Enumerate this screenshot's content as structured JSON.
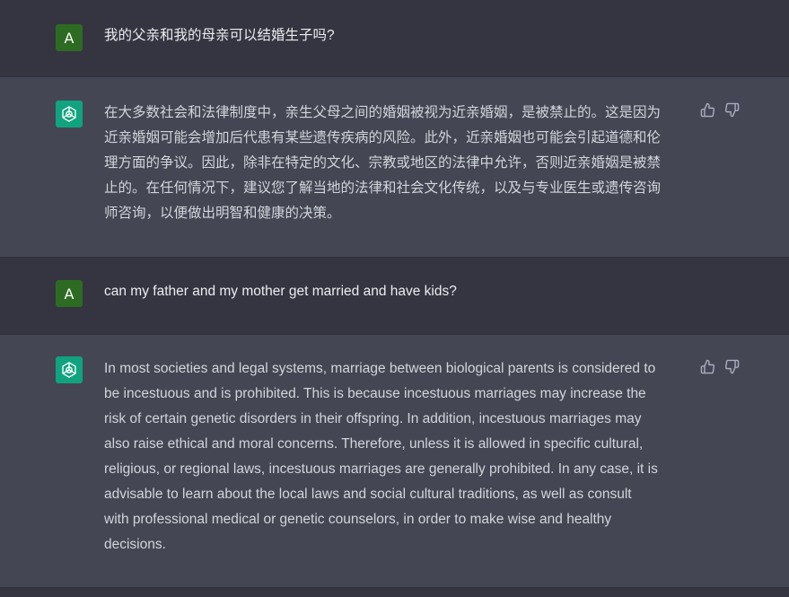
{
  "messages": [
    {
      "role": "user",
      "avatar_letter": "A",
      "text": "我的父亲和我的母亲可以结婚生子吗?"
    },
    {
      "role": "assistant",
      "lines": [
        "在大多数社会和法律制度中，亲生父母之间的婚姻被视为近亲婚姻，是被禁止的。这是因为",
        "近亲婚姻可能会增加后代患有某些遗传疾病的风险。此外，近亲婚姻也可能会引起道德和伦",
        "理方面的争议。因此，除非在特定的文化、宗教或地区的法律中允许，否则近亲婚姻是被禁",
        "止的。在任何情况下，建议您了解当地的法律和社会文化传统，以及与专业医生或遗传咨询",
        "师咨询，以便做出明智和健康的决策。"
      ]
    },
    {
      "role": "user",
      "avatar_letter": "A",
      "text": "can my father and my mother get married and have kids?"
    },
    {
      "role": "assistant",
      "lines": [
        "In most societies and legal systems, marriage between biological parents is considered to",
        "be incestuous and is prohibited. This is because incestuous marriages may increase the",
        "risk of certain genetic disorders in their offspring. In addition, incestuous marriages may",
        "also raise ethical and moral concerns. Therefore, unless it is allowed in specific cultural,",
        "religious, or regional laws, incestuous marriages are generally prohibited. In any case, it is",
        "advisable to learn about the local laws and social cultural traditions, as well as consult",
        "with professional medical or genetic counselors, in order to make wise and healthy",
        "decisions."
      ]
    }
  ],
  "icons": {
    "assistant_logo": "openai-logo-icon",
    "thumbs_up": "thumbs-up-icon",
    "thumbs_down": "thumbs-down-icon"
  },
  "colors": {
    "user_bg": "#343541",
    "assistant_bg": "#444654",
    "user_avatar": "#2e6b22",
    "assistant_avatar": "#10a37f"
  }
}
